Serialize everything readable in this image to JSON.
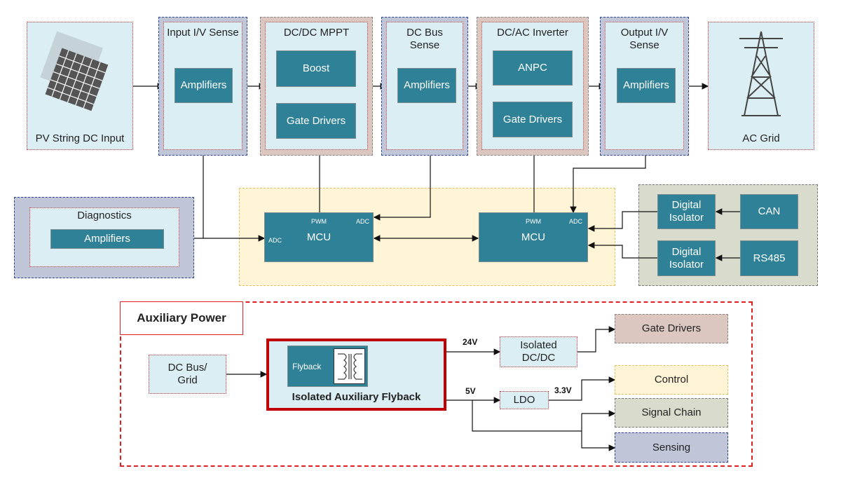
{
  "pv": {
    "label": "PV String DC Input",
    "icon": "solar-panel-icon"
  },
  "input_sense": {
    "title": "Input I/V Sense",
    "block": "Amplifiers"
  },
  "mppt": {
    "title": "DC/DC MPPT",
    "boost": "Boost",
    "gate": "Gate Drivers"
  },
  "dcbus": {
    "title": "DC Bus Sense",
    "block": "Amplifiers"
  },
  "inverter": {
    "title": "DC/AC Inverter",
    "anpc": "ANPC",
    "gate": "Gate Drivers"
  },
  "output_sense": {
    "title": "Output I/V Sense",
    "block": "Amplifiers"
  },
  "grid": {
    "label": "AC Grid",
    "icon": "transmission-tower-icon"
  },
  "diagnostics": {
    "title": "Diagnostics",
    "block": "Amplifiers"
  },
  "mcu1": {
    "label": "MCU",
    "adc_left": "ADC",
    "pwm": "PWM",
    "adc": "ADC"
  },
  "mcu2": {
    "label": "MCU",
    "pwm": "PWM",
    "adc": "ADC"
  },
  "comm": {
    "iso1": "Digital Isolator",
    "iso2": "Digital Isolator",
    "can": "CAN",
    "rs485": "RS485"
  },
  "aux": {
    "title": "Auxiliary Power",
    "input": "DC Bus/ Grid",
    "flyback": "Flyback",
    "flyback_title": "Isolated Auxiliary Flyback",
    "v24": "24V",
    "v5": "5V",
    "v33": "3.3V",
    "iso_dcdc": "Isolated DC/DC",
    "ldo": "LDO",
    "gate": "Gate Drivers",
    "control": "Control",
    "signal": "Signal Chain",
    "sensing": "Sensing"
  },
  "colors": {
    "teal": "#2e8196",
    "light_blue": "#dbeef4",
    "red": "#c00000"
  }
}
